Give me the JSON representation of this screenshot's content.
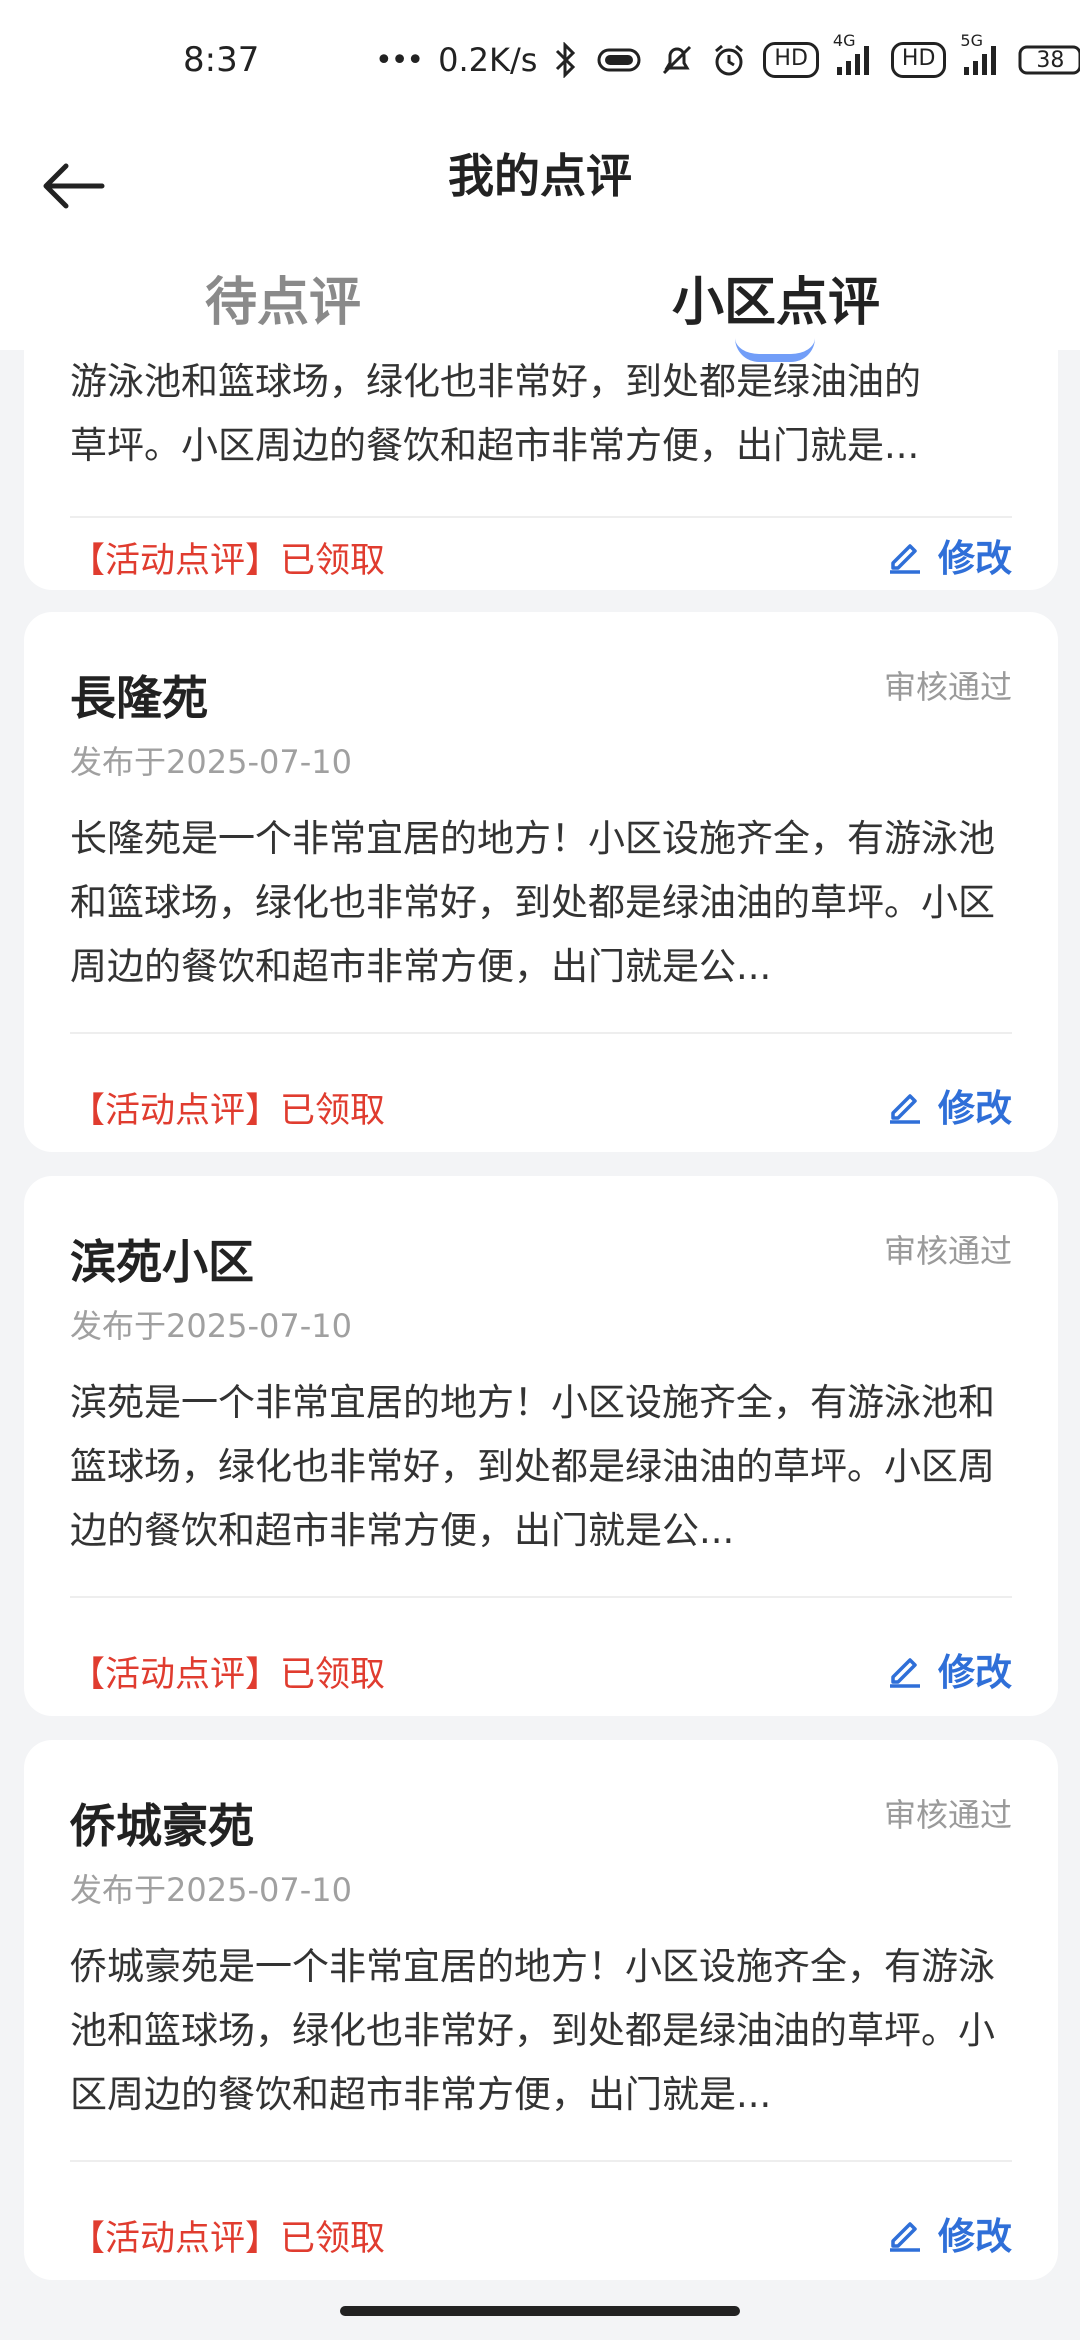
{
  "status_bar": {
    "time": "8:37",
    "network_speed": "0.2K/s",
    "hd1": "HD",
    "net1": "4G",
    "hd2": "HD",
    "net2": "5G",
    "battery": "38"
  },
  "header": {
    "title": "我的点评",
    "tabs": [
      {
        "label": "待点评",
        "active": false
      },
      {
        "label": "小区点评",
        "active": true
      }
    ]
  },
  "partial_card": {
    "text_line1": "游泳池和篮球场，绿化也非常好，到处都是绿油油的",
    "text_line2": "草坪。小区周边的餐饮和超市非常方便，出门就是...",
    "tag": "【活动点评】已领取",
    "edit_label": "修改"
  },
  "reviews": [
    {
      "name": "長隆苑",
      "status": "审核通过",
      "date": "发布于2025-07-10",
      "text": "长隆苑是一个非常宜居的地方！小区设施齐全，有游泳池和篮球场，绿化也非常好，到处都是绿油油的草坪。小区周边的餐饮和超市非常方便，出门就是公...",
      "tag": "【活动点评】已领取",
      "edit_label": "修改"
    },
    {
      "name": "滨苑小区",
      "status": "审核通过",
      "date": "发布于2025-07-10",
      "text": "滨苑是一个非常宜居的地方！小区设施齐全，有游泳池和篮球场，绿化也非常好，到处都是绿油油的草坪。小区周边的餐饮和超市非常方便，出门就是公...",
      "tag": "【活动点评】已领取",
      "edit_label": "修改"
    },
    {
      "name": "侨城豪苑",
      "status": "审核通过",
      "date": "发布于2025-07-10",
      "text": "侨城豪苑是一个非常宜居的地方！小区设施齐全，有游泳池和篮球场，绿化也非常好，到处都是绿油油的草坪。小区周边的餐饮和超市非常方便，出门就是...",
      "tag": "【活动点评】已领取",
      "edit_label": "修改"
    }
  ],
  "colors": {
    "accent": "#2f6fd8",
    "tag_red": "#e03c2f",
    "muted": "#9a9a9a"
  }
}
